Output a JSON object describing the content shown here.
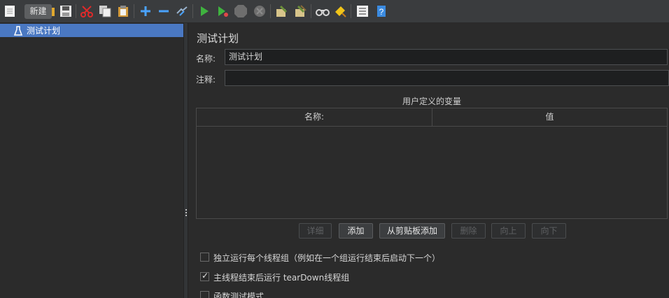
{
  "toolbar": {
    "tooltip": "新建",
    "icons": [
      "new-file-icon",
      "open-icon",
      "save-icon",
      "cut-icon",
      "copy-icon",
      "paste-icon",
      "expand-icon",
      "collapse-icon",
      "toggle-icon",
      "start-icon",
      "start-no-pauses-icon",
      "stop-icon",
      "shutdown-icon",
      "clear-icon",
      "clear-all-icon",
      "search-icon",
      "reset-search-icon",
      "function-helper-icon",
      "help-icon"
    ]
  },
  "tree": {
    "items": [
      {
        "label": "测试计划",
        "icon": "test-plan-icon",
        "selected": true
      }
    ]
  },
  "panel": {
    "title": "测试计划",
    "name_label": "名称:",
    "name_value": "测试计划",
    "comment_label": "注释:",
    "comment_value": "",
    "variables_title": "用户定义的变量",
    "columns": [
      "名称:",
      "值"
    ],
    "rows": [],
    "buttons": [
      {
        "label": "详细",
        "enabled": false
      },
      {
        "label": "添加",
        "enabled": true
      },
      {
        "label": "从剪贴板添加",
        "enabled": true
      },
      {
        "label": "删除",
        "enabled": false
      },
      {
        "label": "向上",
        "enabled": false
      },
      {
        "label": "向下",
        "enabled": false
      }
    ],
    "options": [
      {
        "label": "独立运行每个线程组（例如在一个组运行结束后启动下一个）",
        "checked": false
      },
      {
        "label": "主线程结束后运行 tearDown线程组",
        "checked": true
      },
      {
        "label": "函数测试模式",
        "checked": false
      }
    ]
  },
  "colors": {
    "accent": "#4a78c2",
    "background": "#2b2b2b",
    "toolbar": "#3a3c3e"
  }
}
